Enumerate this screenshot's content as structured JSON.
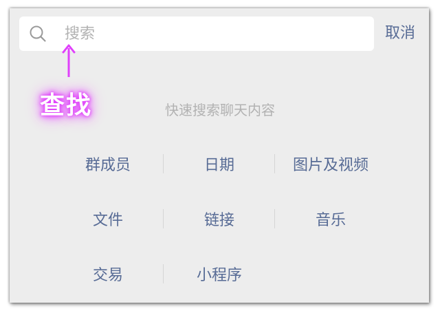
{
  "search": {
    "placeholder": "搜索",
    "cancel_label": "取消"
  },
  "annotation": {
    "label": "查找",
    "color": "#e040fb"
  },
  "hint": "快速搜索聊天内容",
  "categories": [
    [
      "群成员",
      "日期",
      "图片及视频"
    ],
    [
      "文件",
      "链接",
      "音乐"
    ],
    [
      "交易",
      "小程序"
    ]
  ],
  "colors": {
    "link": "#576b95",
    "background": "#ededed",
    "placeholder": "#b2b2b2"
  }
}
